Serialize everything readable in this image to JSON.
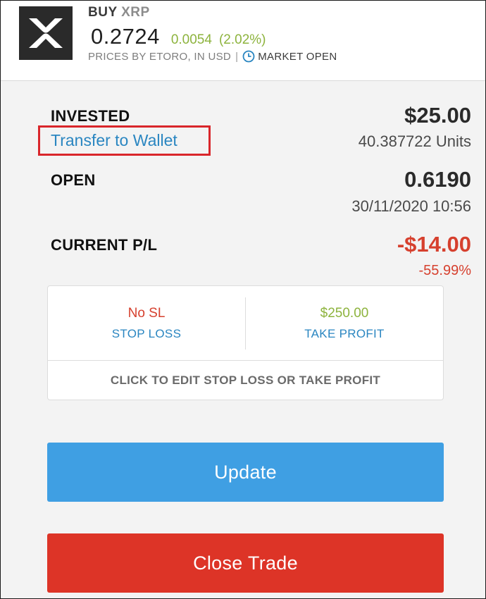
{
  "header": {
    "action": "BUY",
    "symbol": "XRP",
    "price": "0.2724",
    "change": "0.0054",
    "change_pct": "(2.02%)",
    "source": "PRICES BY ETORO, IN USD",
    "separator": "|",
    "market_status": "MARKET OPEN",
    "logo_icon": "xrp-logo-icon",
    "clock_icon": "clock-icon"
  },
  "invested": {
    "label": "INVESTED",
    "link": "Transfer to Wallet",
    "amount": "$25.00",
    "units": "40.387722 Units"
  },
  "open": {
    "label": "OPEN",
    "rate": "0.6190",
    "datetime": "30/11/2020 10:56"
  },
  "pl": {
    "label": "CURRENT P/L",
    "amount": "-$14.00",
    "pct": "-55.99%"
  },
  "risk": {
    "stop_loss_value": "No SL",
    "stop_loss_label": "STOP LOSS",
    "take_profit_value": "$250.00",
    "take_profit_label": "TAKE PROFIT",
    "edit_hint": "CLICK TO EDIT STOP LOSS OR TAKE PROFIT"
  },
  "buttons": {
    "update": "Update",
    "close": "Close Trade"
  },
  "colors": {
    "accent_blue": "#2a86c1",
    "positive_green": "#8db33d",
    "negative_red": "#d6402e",
    "update_button": "#3f9fe3",
    "close_button": "#dd3427",
    "highlight_box": "#d9262b"
  }
}
